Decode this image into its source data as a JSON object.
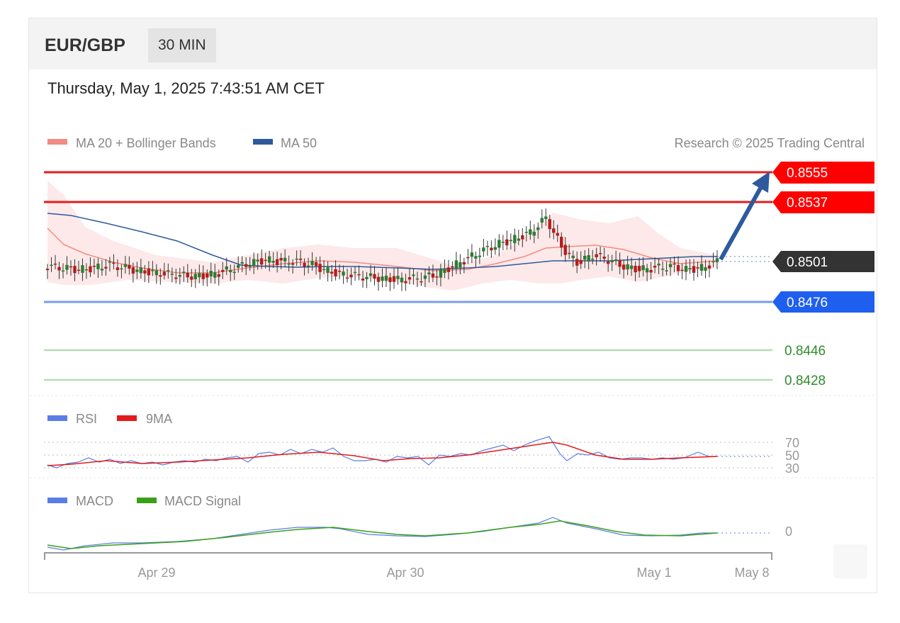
{
  "header": {
    "pair": "EUR/GBP",
    "timeframe": "30 MIN"
  },
  "datetime": "Thursday, May 1, 2025 7:43:51 AM CET",
  "legend_main": [
    {
      "label": "MA 20 + Bollinger Bands",
      "color": "#f28b82"
    },
    {
      "label": "MA 50",
      "color": "#2e5a9c"
    }
  ],
  "copyright": "Research © 2025 Trading Central",
  "legend_rsi": [
    {
      "label": "RSI",
      "color": "#5b7ee5"
    },
    {
      "label": "9MA",
      "color": "#e21b1b"
    }
  ],
  "legend_macd": [
    {
      "label": "MACD",
      "color": "#5b7ee5"
    },
    {
      "label": "MACD Signal",
      "color": "#3aa01a"
    }
  ],
  "levels": [
    {
      "value": "0.8555",
      "type": "resistance",
      "color": "#e51c1c"
    },
    {
      "value": "0.8537",
      "type": "resistance",
      "color": "#e51c1c"
    },
    {
      "value": "0.8501",
      "type": "current",
      "color": "#333333"
    },
    {
      "value": "0.8476",
      "type": "pivot",
      "color": "#2163e8"
    },
    {
      "value": "0.8446",
      "type": "support",
      "color": "#3a9a2a"
    },
    {
      "value": "0.8428",
      "type": "support",
      "color": "#3a9a2a"
    }
  ],
  "rsi_ticks": [
    "70",
    "50",
    "30"
  ],
  "macd_ticks": [
    "0"
  ],
  "x_ticks": [
    "Apr 29",
    "Apr 30",
    "May 1",
    "May 8"
  ],
  "chart_data": {
    "type": "candlestick",
    "y_axis_levels": [
      0.8555,
      0.8537,
      0.8501,
      0.8476,
      0.8446,
      0.8428
    ],
    "current_price": 0.8501,
    "close_approx": [
      0.8498,
      0.8497,
      0.8496,
      0.8497,
      0.8499,
      0.8497,
      0.8495,
      0.8494,
      0.8493,
      0.8492,
      0.8492,
      0.8494,
      0.8497,
      0.85,
      0.8502,
      0.8501,
      0.8501,
      0.8499,
      0.8495,
      0.8493,
      0.8492,
      0.8491,
      0.849,
      0.849,
      0.8491,
      0.8493,
      0.8498,
      0.8503,
      0.8508,
      0.8512,
      0.8515,
      0.8519,
      0.8528,
      0.851,
      0.85,
      0.8505,
      0.8502,
      0.8498,
      0.8496,
      0.8497,
      0.8498,
      0.8496,
      0.8497,
      0.8501
    ]
  }
}
